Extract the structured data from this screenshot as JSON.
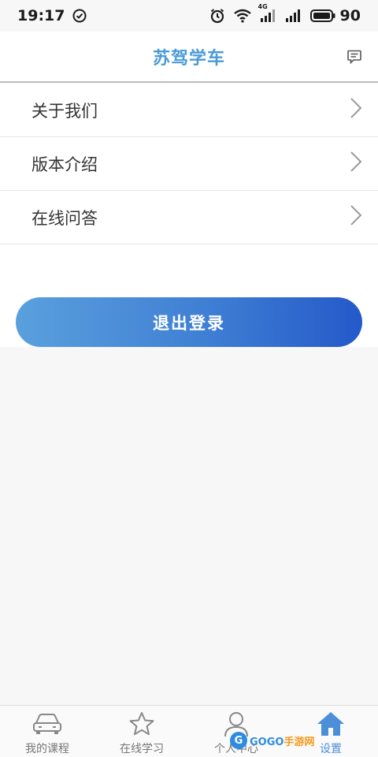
{
  "status_bar": {
    "time": "19:17",
    "network": "4G",
    "battery": "90"
  },
  "header": {
    "title": "苏驾学车"
  },
  "menu": {
    "items": [
      {
        "label": "关于我们"
      },
      {
        "label": "版本介绍"
      },
      {
        "label": "在线问答"
      }
    ]
  },
  "logout": {
    "label": "退出登录"
  },
  "bottom_nav": {
    "items": [
      {
        "label": "我的课程",
        "icon": "car-icon"
      },
      {
        "label": "在线学习",
        "icon": "star-icon"
      },
      {
        "label": "个人中心",
        "icon": "user-icon"
      },
      {
        "label": "设置",
        "icon": "home-icon",
        "active": true
      }
    ]
  },
  "watermark": {
    "letter": "G",
    "text_a": "GOGO",
    "text_b": "手游网"
  },
  "colors": {
    "accent": "#4a9ad8",
    "button_start": "#5aa0dd",
    "button_end": "#2459c9"
  }
}
